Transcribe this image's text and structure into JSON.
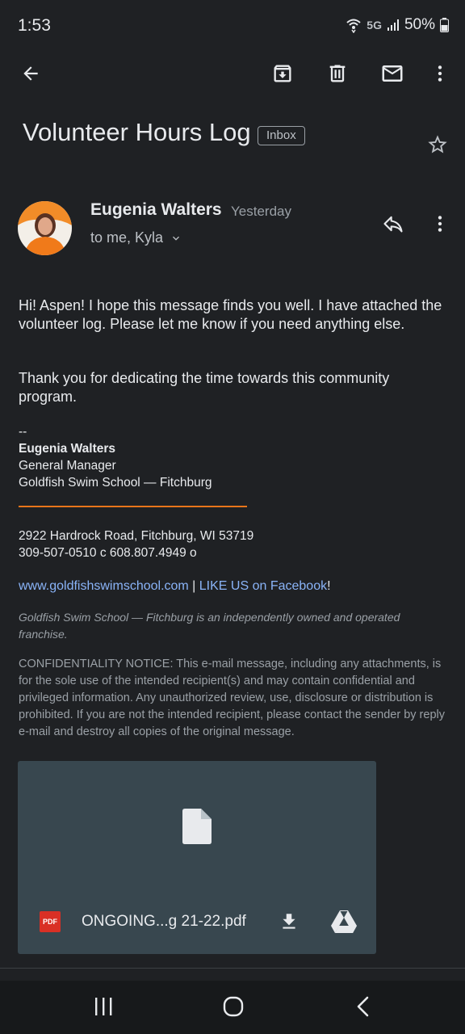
{
  "status_bar": {
    "time": "1:53",
    "network": "5G",
    "battery": "50%"
  },
  "toolbar": {
    "icons": [
      "back-arrow-icon",
      "archive-icon",
      "delete-icon",
      "mark-unread-icon",
      "more-vert-icon"
    ]
  },
  "email": {
    "subject": "Volunteer Hours Log",
    "label": "Inbox",
    "sender": "Eugenia Walters",
    "time": "Yesterday",
    "recipients": "to me, Kyla",
    "body": [
      "Hi! Aspen! I hope this message finds you well. I have attached the volunteer log. Please let me know if you need anything else.",
      "Thank you for dedicating the time towards this community program."
    ],
    "signature": {
      "dashes": "--",
      "name": "Eugenia Walters",
      "title": "General Manager",
      "company": "Goldfish Swim School — Fitchburg",
      "address": "2922 Hardrock Road, Fitchburg, WI 53719",
      "phones": "309-507-0510 c 608.807.4949 o",
      "website": "www.goldfishswimschool.com",
      "separator": " | ",
      "facebook": "LIKE US on Facebook",
      "exclaim": "!",
      "franchise_note": "Goldfish Swim School — Fitchburg is an independently owned and operated franchise.",
      "confidentiality": "CONFIDENTIALITY NOTICE: This e-mail message, including any attachments, is for the sole use of the intended recipient(s) and may contain confidential and privileged information. Any unauthorized review, use, disclosure or distribution is prohibited.  If you are not the intended recipient, please contact the sender by reply e-mail and destroy all copies of the original message."
    },
    "attachment": {
      "type_badge": "PDF",
      "filename": "ONGOING...g 21-22.pdf"
    }
  },
  "colors": {
    "background": "#1f2124",
    "link": "#8ab4f8",
    "accent_orange": "#e8751a",
    "attachment_card": "#38474f"
  }
}
